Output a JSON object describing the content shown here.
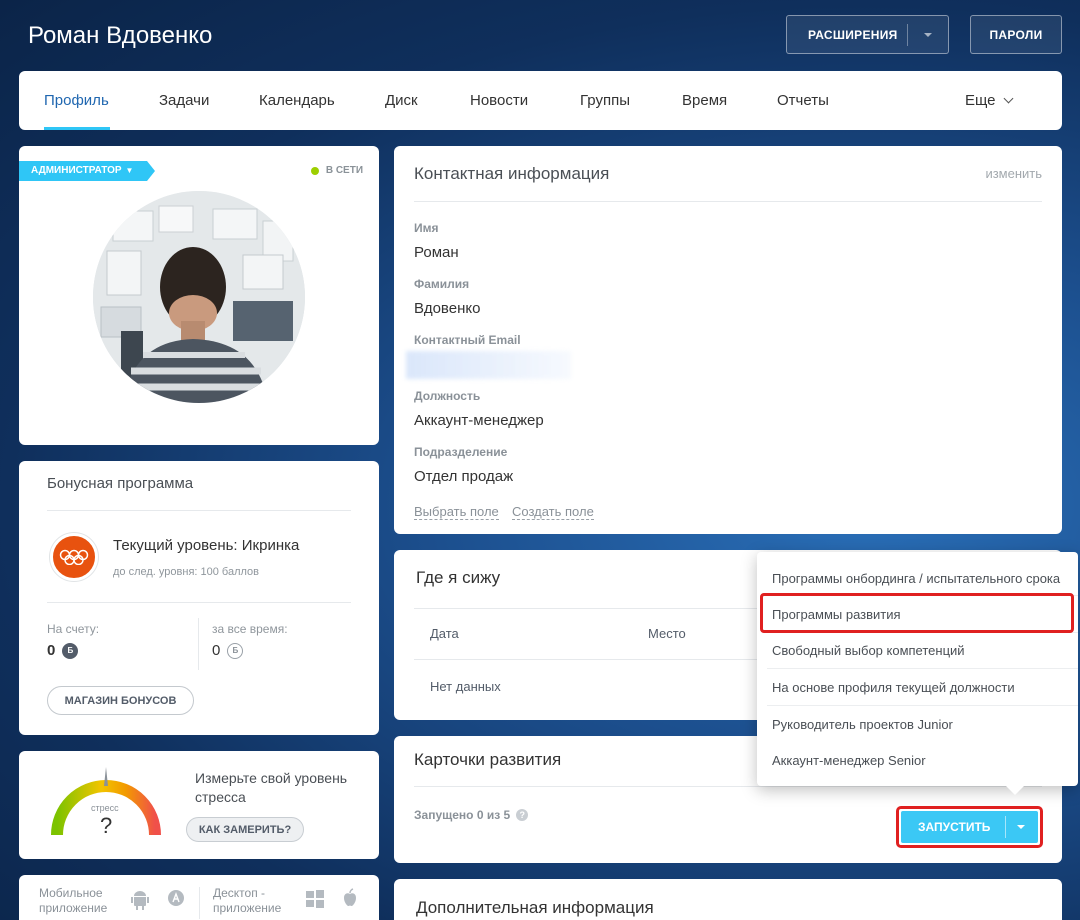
{
  "header": {
    "user_name": "Роман Вдовенко",
    "extensions_label": "РАСШИРЕНИЯ",
    "passwords_label": "ПАРОЛИ"
  },
  "nav": {
    "tabs": [
      {
        "label": "Профиль",
        "active": true
      },
      {
        "label": "Задачи"
      },
      {
        "label": "Календарь"
      },
      {
        "label": "Диск"
      },
      {
        "label": "Новости"
      },
      {
        "label": "Группы"
      },
      {
        "label": "Время"
      },
      {
        "label": "Отчеты"
      }
    ],
    "more_label": "Еще"
  },
  "profile": {
    "role_badge": "АДМИНИСТРАТОР",
    "status": "В СЕТИ",
    "status_color": "#9dcf00"
  },
  "bonus": {
    "title": "Бонусная программа",
    "level": "Текущий уровень: Икринка",
    "next_level": "до след. уровня: 100 баллов",
    "balance_label": "На счету:",
    "balance_value": "0",
    "total_label": "за все время:",
    "total_value": "0",
    "coin_symbol": "Б",
    "shop_button": "МАГАЗИН БОНУСОВ"
  },
  "stress": {
    "gauge_label": "стресс",
    "gauge_value": "?",
    "text": "Измерьте свой уровень стресса",
    "measure_button": "КАК ЗАМЕРИТЬ?"
  },
  "apps": {
    "mobile_label": "Мобильное приложение",
    "desktop_label": "Десктоп - приложение"
  },
  "contact": {
    "title": "Контактная информация",
    "edit": "изменить",
    "fields": [
      {
        "label": "Имя",
        "value": "Роман"
      },
      {
        "label": "Фамилия",
        "value": "Вдовенко"
      },
      {
        "label": "Контактный Email",
        "value": ""
      },
      {
        "label": "Должность",
        "value": "Аккаунт-менеджер"
      },
      {
        "label": "Подразделение",
        "value": "Отдел продаж"
      }
    ],
    "choose_field": "Выбрать поле",
    "create_field": "Создать поле"
  },
  "seat": {
    "title": "Где я сижу",
    "col_date": "Дата",
    "col_place": "Место",
    "empty": "Нет данных"
  },
  "dev_cards": {
    "title": "Карточки развития",
    "launched": "Запущено 0 из 5",
    "help": "?",
    "launch_button": "ЗАПУСТИТЬ"
  },
  "dropdown": {
    "items": [
      "Программы онбординга / испытательного срока",
      "Программы развития",
      "Свободный выбор компетенций",
      "На основе профиля текущей должности",
      "Руководитель проектов Junior",
      "Аккаунт-менеджер Senior"
    ]
  },
  "extra": {
    "title": "Дополнительная информация"
  },
  "colors": {
    "accent": "#2fc6f6",
    "active_tab": "#2067b0",
    "launch_button": "#3bc8f5",
    "highlight": "#e02020"
  }
}
